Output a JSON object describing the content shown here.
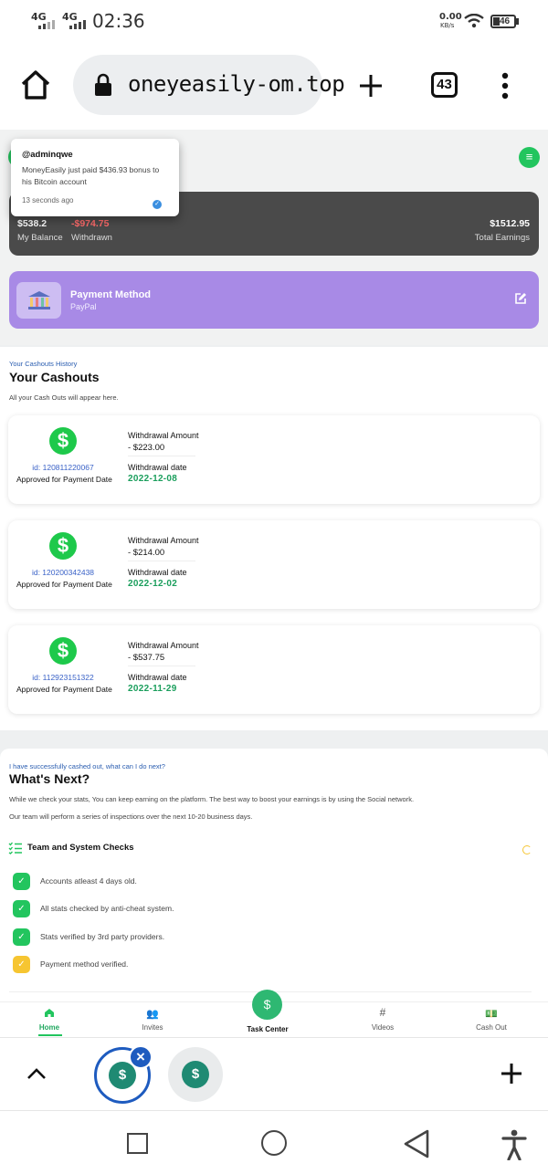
{
  "status_bar": {
    "network1": "4G",
    "network2": "4G",
    "time": "02:36",
    "speed_value": "0.00",
    "speed_unit": "KB/s",
    "battery": "46"
  },
  "browser": {
    "url": "oneyeasily-om.top",
    "tab_count": "43"
  },
  "toast": {
    "user": "@adminqwe",
    "message": "MoneyEasily just paid $436.93 bonus to his Bitcoin account",
    "time": "13 seconds ago"
  },
  "balance": {
    "my_balance_value": "$538.2",
    "my_balance_label": "My Balance",
    "withdrawn_value": "-$974.75",
    "withdrawn_label": "Withdrawn",
    "total_value": "$1512.95",
    "total_label": "Total Earnings"
  },
  "payment": {
    "title": "Payment Method",
    "method": "PayPal"
  },
  "cashouts": {
    "eyebrow": "Your Cashouts History",
    "title": "Your Cashouts",
    "subtitle": "All your Cash Outs will appear here.",
    "items": [
      {
        "id": "id: 120811220067",
        "status": "Approved for Payment Date",
        "amount_label": "Withdrawal Amount",
        "amount": "- $223.00",
        "date_label": "Withdrawal date",
        "date": "2022-12-08"
      },
      {
        "id": "id: 120200342438",
        "status": "Approved for Payment Date",
        "amount_label": "Withdrawal Amount",
        "amount": "- $214.00",
        "date_label": "Withdrawal date",
        "date": "2022-12-02"
      },
      {
        "id": "id: 112923151322",
        "status": "Approved for Payment Date",
        "amount_label": "Withdrawal Amount",
        "amount": "- $537.75",
        "date_label": "Withdrawal date",
        "date": "2022-11-29"
      }
    ]
  },
  "next": {
    "eyebrow": "I have successfully cashed out, what can I do next?",
    "title": "What's Next?",
    "para1": "While we check your stats, You can keep earning on the platform. The best way to boost your earnings is by using the Social network.",
    "para2": "Our team will perform a series of inspections over the next 10-20 business days.",
    "checks_title": "Team and System Checks",
    "checks": [
      {
        "text": "Accounts atleast 4 days old.",
        "state": "done"
      },
      {
        "text": "All stats checked by anti-cheat system.",
        "state": "done"
      },
      {
        "text": "Stats verified by 3rd party providers.",
        "state": "done"
      },
      {
        "text": "Payment method verified.",
        "state": "pending"
      }
    ]
  },
  "bottom_nav": {
    "home": "Home",
    "invites": "Invites",
    "task_center": "Task Center",
    "videos": "Videos",
    "cashout": "Cash Out"
  },
  "colors": {
    "accent_green": "#22c55e",
    "balance_card": "#4a4a4a",
    "payment_card": "#a88ae6",
    "withdrawn_red": "#ff6b6b",
    "date_green": "#1a9e5c"
  }
}
